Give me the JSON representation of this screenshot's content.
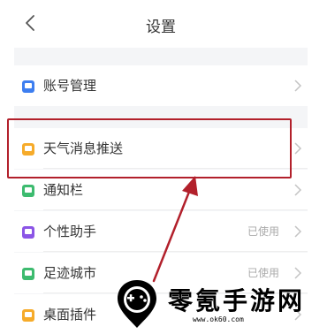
{
  "header": {
    "title": "设置",
    "back_icon": "chevron-left-icon"
  },
  "rows": [
    {
      "label": "账号管理",
      "status": "",
      "icon": "account-icon",
      "icon_color": "#3d7ef0"
    },
    {
      "label": "天气消息推送",
      "status": "",
      "icon": "push-icon",
      "icon_color": "#f6ab2a"
    },
    {
      "label": "通知栏",
      "status": "",
      "icon": "notification-icon",
      "icon_color": "#3dbb6f"
    },
    {
      "label": "个性助手",
      "status": "已使用",
      "icon": "assistant-icon",
      "icon_color": "#8b55e6"
    },
    {
      "label": "足迹城市",
      "status": "已使用",
      "icon": "footprint-icon",
      "icon_color": "#3dbb6f"
    },
    {
      "label": "桌面插件",
      "status": "",
      "icon": "widget-icon",
      "icon_color": "#f6ab2a"
    }
  ],
  "annotation": {
    "highlight_color": "#b2202b"
  },
  "watermark": {
    "name": "零氪手游网",
    "url": "www.ok60.com"
  }
}
